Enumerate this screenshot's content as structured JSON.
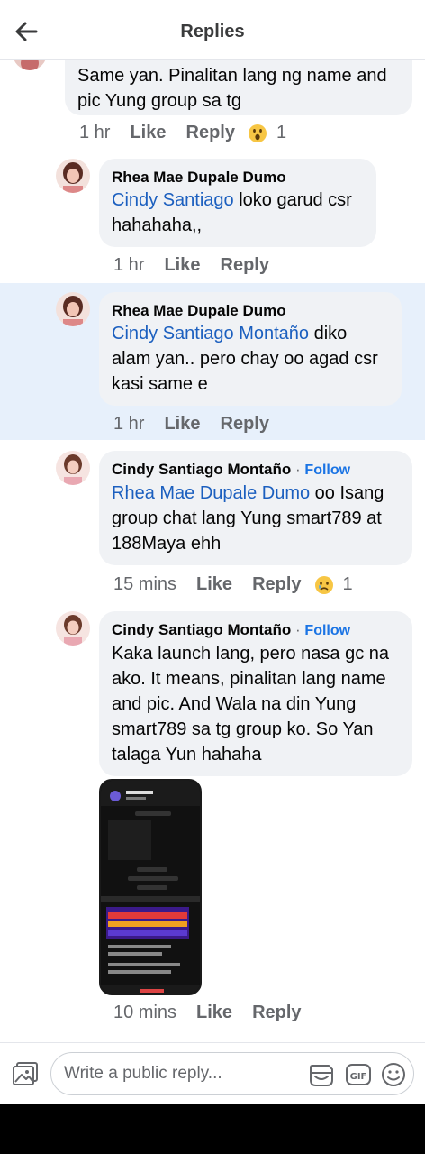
{
  "header": {
    "title": "Replies"
  },
  "comments": [
    {
      "text": "Same yan. Pinalitan lang ng name and pic Yung group sa tg",
      "time": "1 hr",
      "like": "Like",
      "reply": "Reply",
      "reaction": "wow",
      "reaction_count": "1"
    },
    {
      "author": "Rhea Mae Dupale Dumo",
      "mention": "Cindy Santiago",
      "text": " loko garud csr hahahaha,,",
      "time": "1 hr",
      "like": "Like",
      "reply": "Reply"
    },
    {
      "author": "Rhea Mae Dupale Dumo",
      "mention": "Cindy Santiago Montaño",
      "text": " diko alam yan.. pero chay oo agad csr kasi same e",
      "time": "1 hr",
      "like": "Like",
      "reply": "Reply"
    },
    {
      "author": "Cindy Santiago Montaño",
      "dot": "·",
      "follow": "Follow",
      "mention": "Rhea Mae Dupale Dumo",
      "text": "  oo Isang group chat lang Yung smart789 at 188Maya ehh",
      "time": "15 mins",
      "like": "Like",
      "reply": "Reply",
      "reaction": "sad",
      "reaction_count": "1"
    },
    {
      "author": "Cindy Santiago Montaño",
      "dot": "·",
      "follow": "Follow",
      "text": "Kaka launch lang, pero nasa gc na ako. It means, pinalitan lang name and pic. And Wala na din Yung smart789 sa tg group ko. So Yan talaga Yun hahaha",
      "time": "10 mins",
      "like": "Like",
      "reply": "Reply"
    }
  ],
  "composer": {
    "placeholder": "Write a public reply..."
  },
  "icons": {
    "back": "arrow-left-icon",
    "gallery": "image-gallery-icon",
    "sticker": "sticker-icon",
    "gif": "gif-icon",
    "emoji": "emoji-icon"
  },
  "colors": {
    "link": "#1b5fbf",
    "follow": "#1b74e4",
    "highlight": "#e7f0fb",
    "bubble": "#f0f2f5"
  }
}
